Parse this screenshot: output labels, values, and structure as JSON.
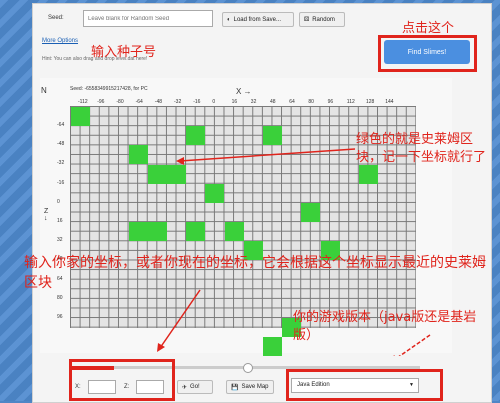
{
  "seed": {
    "label": "Seed:",
    "placeholder": "Leave blank for Random Seed"
  },
  "buttons": {
    "load": "Load from Save...",
    "random": "Random",
    "find": "Find Slimes!",
    "go": "Go!",
    "save_map": "Save Map"
  },
  "links": {
    "more_options": "More Options"
  },
  "hint": "Hint: You can also drag and drop level.dat here!",
  "map": {
    "seed_info": "Seed: -6558349915217428, for PC",
    "x_axis": "X →",
    "z_axis": "Z\n↓",
    "compass": "N",
    "x_ticks": [
      "-112",
      "-96",
      "-80",
      "-64",
      "-48",
      "-32",
      "-16",
      "0",
      "16",
      "32",
      "48",
      "64",
      "80",
      "96",
      "112",
      "128",
      "144"
    ],
    "z_ticks": [
      "-64",
      "-48",
      "-32",
      "-16",
      "0",
      "16",
      "32",
      "48",
      "64",
      "80",
      "96"
    ],
    "slime_chunks": [
      {
        "x": 0,
        "z": 0
      },
      {
        "x": 3,
        "z": 2
      },
      {
        "x": 6,
        "z": 1
      },
      {
        "x": 7,
        "z": 4
      },
      {
        "x": 4,
        "z": 3
      },
      {
        "x": 5,
        "z": 3
      },
      {
        "x": 10,
        "z": 1
      },
      {
        "x": 12,
        "z": 5
      },
      {
        "x": 3,
        "z": 6
      },
      {
        "x": 4,
        "z": 6
      },
      {
        "x": 6,
        "z": 6
      },
      {
        "x": 8,
        "z": 6
      },
      {
        "x": 9,
        "z": 7
      },
      {
        "x": 13,
        "z": 7
      },
      {
        "x": 15,
        "z": 3
      },
      {
        "x": 11,
        "z": 11
      },
      {
        "x": 10,
        "z": 12
      },
      {
        "x": 3,
        "z": 13
      }
    ]
  },
  "coords": {
    "x_label": "X:",
    "z_label": "Z:"
  },
  "edition": {
    "selected": "Java Edition"
  },
  "annotations": {
    "a1": "点击这个",
    "a2": "输入种子号",
    "a3": "绿色的就是史莱姆区块，记一下坐标就行了",
    "a4": "输入你家的坐标，或者你现在的坐标，它会根据这个坐标显示最近的史莱姆区块",
    "a5": "你的游戏版本（java版还是基岩版）"
  },
  "colors": {
    "slime": "#3ad03a",
    "annotation": "#e0241c",
    "find_button": "#4b8fe0"
  }
}
